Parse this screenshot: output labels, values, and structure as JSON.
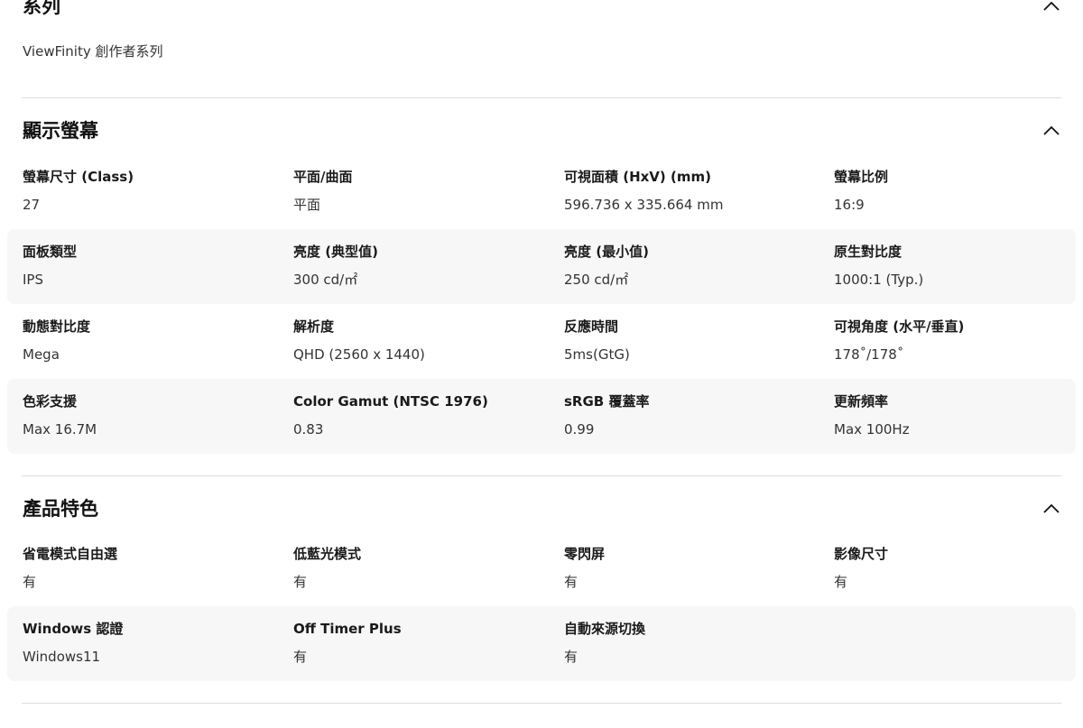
{
  "series": {
    "title": "系列",
    "value": "ViewFinity 創作者系列"
  },
  "display": {
    "title": "顯示螢幕",
    "rows": [
      [
        {
          "label": "螢幕尺寸 (Class)",
          "value": "27"
        },
        {
          "label": "平面/曲面",
          "value": "平面"
        },
        {
          "label": "可視面積 (HxV) (mm)",
          "value": "596.736 x 335.664 mm"
        },
        {
          "label": "螢幕比例",
          "value": "16:9"
        }
      ],
      [
        {
          "label": "面板類型",
          "value": "IPS"
        },
        {
          "label": "亮度 (典型值)",
          "value": "300 cd/㎡"
        },
        {
          "label": "亮度 (最小值)",
          "value": "250 cd/㎡"
        },
        {
          "label": "原生對比度",
          "value": "1000:1 (Typ.)"
        }
      ],
      [
        {
          "label": "動態對比度",
          "value": "Mega"
        },
        {
          "label": "解析度",
          "value": "QHD (2560 x 1440)"
        },
        {
          "label": "反應時間",
          "value": "5ms(GtG)"
        },
        {
          "label": "可視角度 (水平/垂直)",
          "value": "178˚/178˚"
        }
      ],
      [
        {
          "label": "色彩支援",
          "value": "Max 16.7M"
        },
        {
          "label": "Color Gamut (NTSC 1976)",
          "value": "0.83"
        },
        {
          "label": "sRGB 覆蓋率",
          "value": "0.99"
        },
        {
          "label": "更新頻率",
          "value": "Max 100Hz"
        }
      ]
    ]
  },
  "features": {
    "title": "產品特色",
    "rows": [
      [
        {
          "label": "省電模式自由選",
          "value": "有"
        },
        {
          "label": "低藍光模式",
          "value": "有"
        },
        {
          "label": "零閃屏",
          "value": "有"
        },
        {
          "label": "影像尺寸",
          "value": "有"
        }
      ],
      [
        {
          "label": "Windows 認證",
          "value": "Windows11"
        },
        {
          "label": "Off Timer Plus",
          "value": "有"
        },
        {
          "label": "自動來源切換",
          "value": "有"
        }
      ]
    ]
  },
  "icons": {
    "collapse": "chevron-up-icon"
  },
  "colors": {
    "shaded_row": "#f7f7f7",
    "divider": "#dcdcdc"
  }
}
